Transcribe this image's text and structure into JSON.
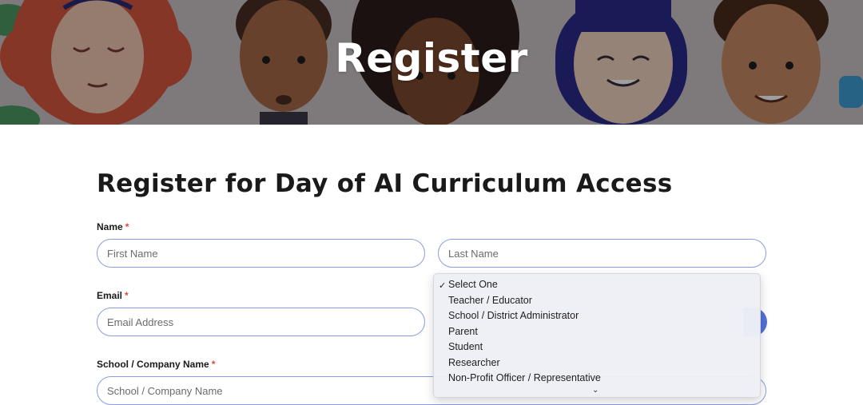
{
  "hero": {
    "title": "Register"
  },
  "form": {
    "title": "Register for Day of AI Curriculum Access",
    "required_mark": "*",
    "name": {
      "label": "Name",
      "first_placeholder": "First Name",
      "last_placeholder": "Last Name"
    },
    "email": {
      "label": "Email",
      "placeholder": "Email Address"
    },
    "school": {
      "label": "School / Company Name",
      "placeholder": "School / Company Name"
    }
  },
  "dropdown": {
    "selected": "Select One",
    "options": [
      "Select One",
      "Teacher / Educator",
      "School / District Administrator",
      "Parent",
      "Student",
      "Researcher",
      "Non-Profit Officer / Representative"
    ],
    "check_icon": "checkmark-icon",
    "more_icon": "chevron-down-icon"
  },
  "colors": {
    "field_border": "#8a9de0",
    "accent": "#5570d6",
    "required": "#e0463b"
  }
}
